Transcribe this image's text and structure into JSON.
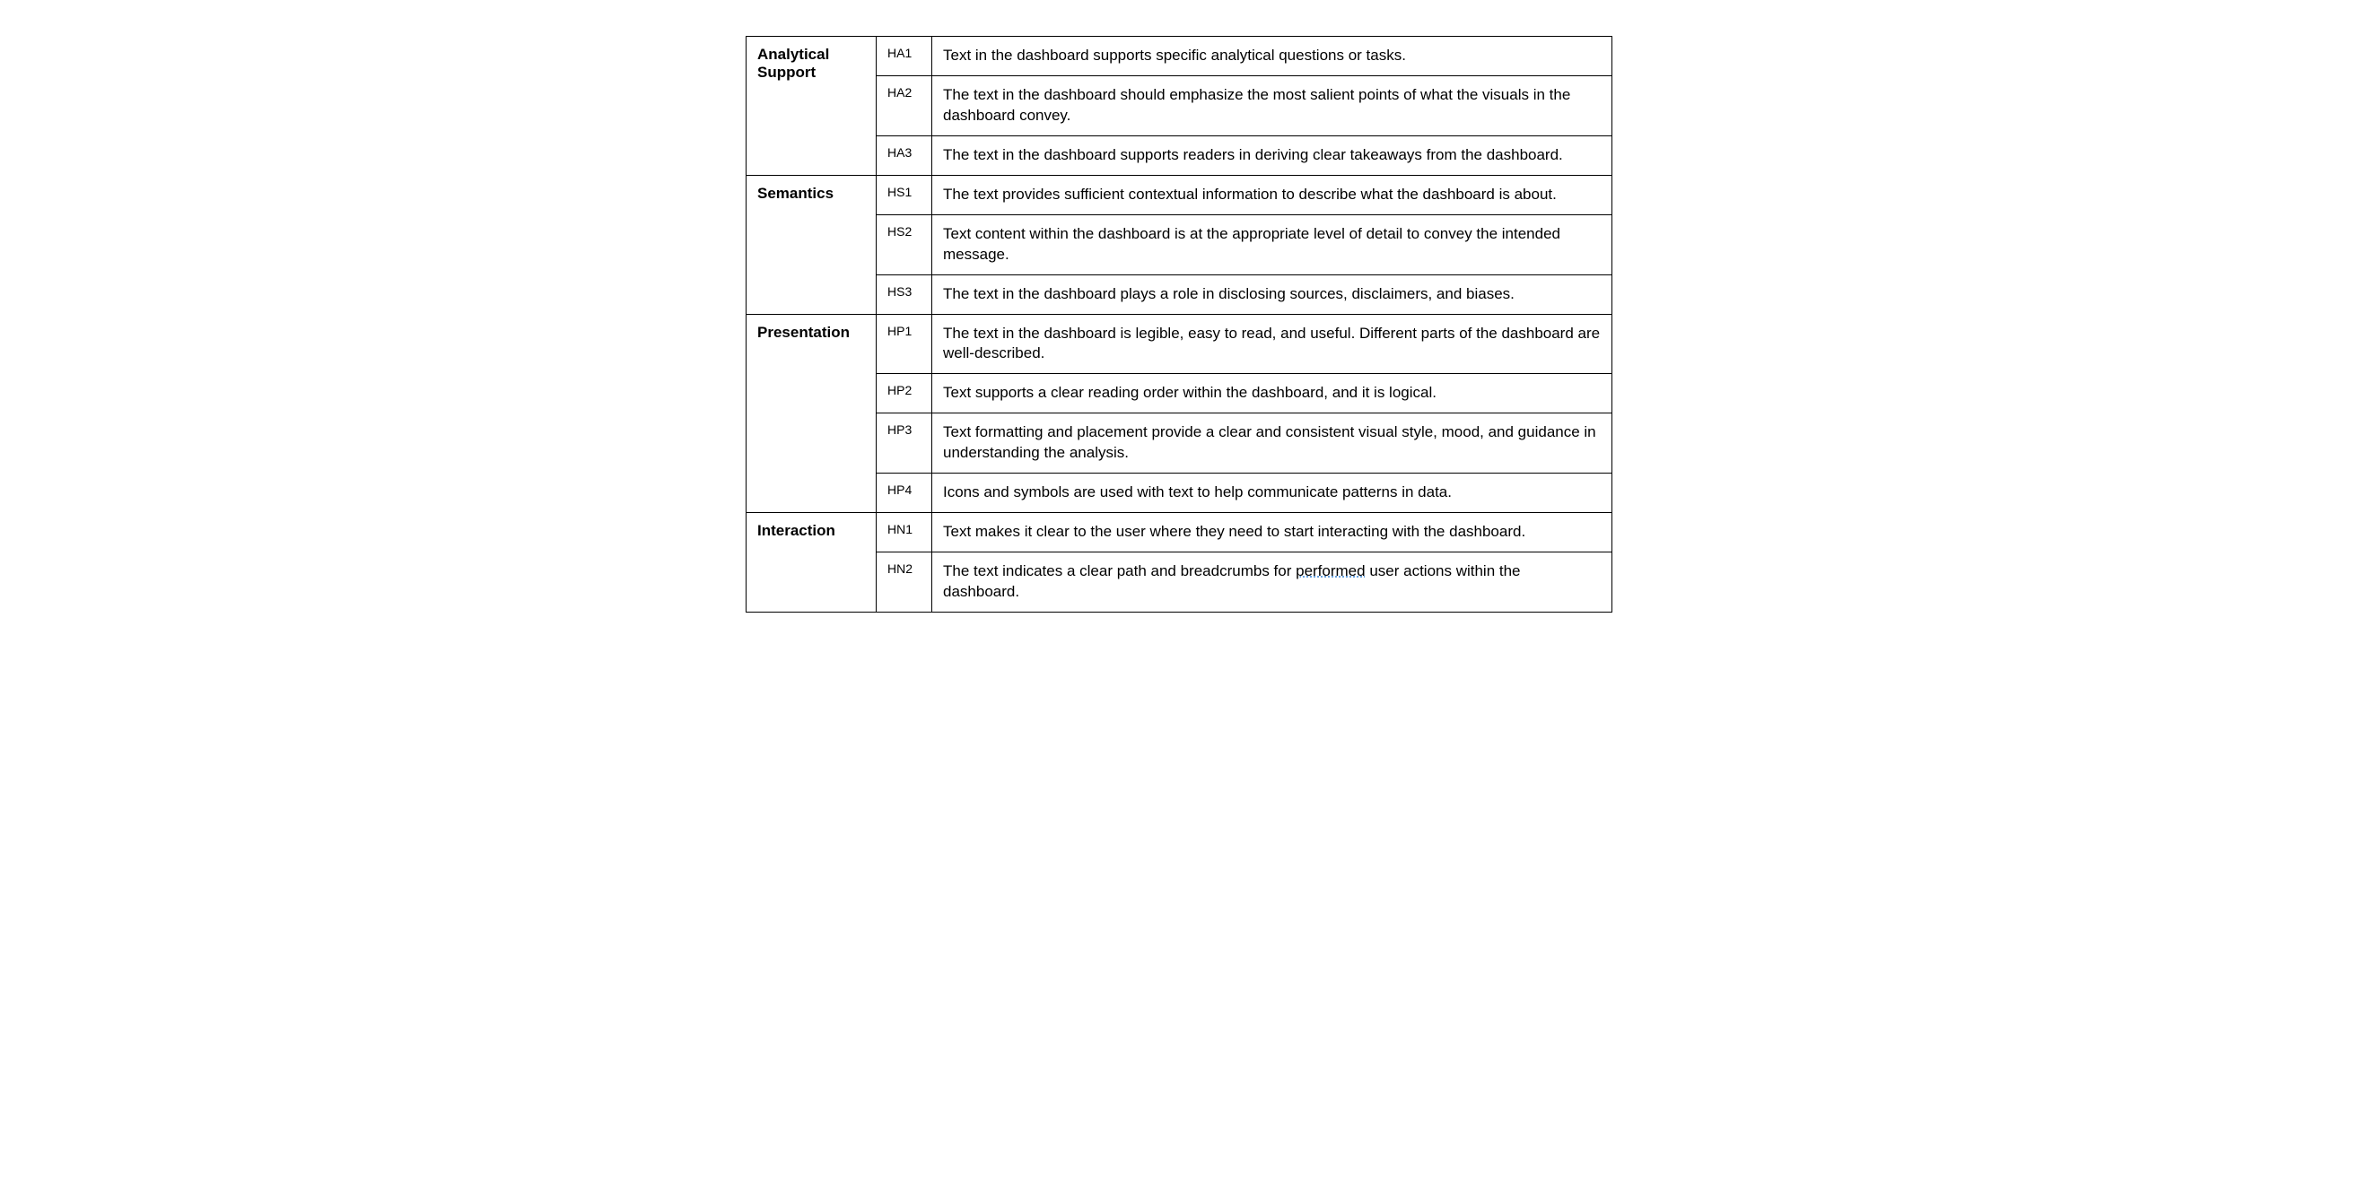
{
  "categories": [
    {
      "name": "Analytical Support",
      "rows": [
        {
          "code": "HA1",
          "desc": "Text in the dashboard supports specific analytical questions or tasks."
        },
        {
          "code": "HA2",
          "desc": "The text in the dashboard should emphasize the most salient points of what the visuals in the dashboard convey."
        },
        {
          "code": "HA3",
          "desc": "The text in the dashboard supports readers in deriving clear takeaways from the dashboard."
        }
      ]
    },
    {
      "name": "Semantics",
      "rows": [
        {
          "code": "HS1",
          "desc": "The text provides sufficient contextual information to describe what the dashboard is about."
        },
        {
          "code": "HS2",
          "desc": "Text content within the dashboard is at the appropriate level of detail to convey the intended message."
        },
        {
          "code": "HS3",
          "desc": "The text in the dashboard plays a role in disclosing sources, disclaimers, and biases."
        }
      ]
    },
    {
      "name": "Presentation",
      "rows": [
        {
          "code": "HP1",
          "desc": "The text in the dashboard is legible, easy to read, and useful. Different parts of the dashboard are well-described."
        },
        {
          "code": "HP2",
          "desc": "Text supports a clear reading order within the dashboard, and it is logical."
        },
        {
          "code": "HP3",
          "desc": "Text formatting and placement provide a clear and consistent visual style, mood, and guidance in understanding the analysis."
        },
        {
          "code": "HP4",
          "desc": "Icons and symbols are used with text to help communicate patterns in data."
        }
      ]
    },
    {
      "name": "Interaction",
      "rows": [
        {
          "code": "HN1",
          "desc": "Text makes it clear to the user where they need to start interacting with the dashboard."
        },
        {
          "code": "HN2",
          "desc_prefix": "The text indicates a clear path and breadcrumbs for ",
          "desc_underlined": "performed",
          "desc_suffix": " user actions within the dashboard."
        }
      ]
    }
  ]
}
